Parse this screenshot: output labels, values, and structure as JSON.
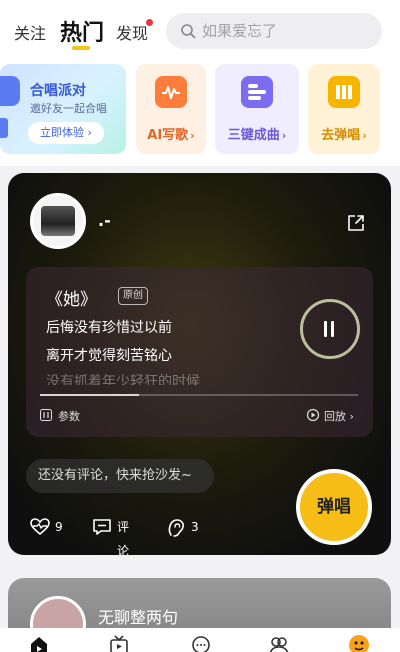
{
  "top_nav": {
    "tabs": [
      {
        "label": "关注",
        "active": false
      },
      {
        "label": "热门",
        "active": true
      },
      {
        "label": "发现",
        "active": false,
        "has_dot": true
      }
    ]
  },
  "search": {
    "placeholder": "如果爱忘了",
    "value": ""
  },
  "features": [
    {
      "title": "合唱派对",
      "subtitle": "邀好友一起合唱",
      "button": "立即体验",
      "chevron": "›"
    },
    {
      "label": "AI写歌",
      "chevron": "›",
      "icon": "ai-write-icon"
    },
    {
      "label": "三键成曲",
      "chevron": "›",
      "icon": "three-key-icon"
    },
    {
      "label": "去弹唱",
      "chevron": "›",
      "icon": "play-sing-icon"
    }
  ],
  "post": {
    "username": ".-",
    "song_title": "《她》",
    "badge": "原创",
    "lyrics": [
      "后悔没有珍惜过以前",
      "离开才觉得刻苦铭心",
      "没有抓着年少轻狂的时候"
    ],
    "playback_progress": 0.31,
    "params_label": "参数",
    "replay_label": "回放",
    "replay_chevron": "›",
    "comment_placeholder": "还没有评论，快来抢沙发~",
    "likes": "9",
    "comment_label": "评论",
    "listens": "3",
    "sing_button": "弹唱",
    "state": "playing"
  },
  "next_post": {
    "title": "无聊整两句"
  },
  "colors": {
    "accent": "#f7bd17",
    "badge_dot": "#e8363c"
  }
}
